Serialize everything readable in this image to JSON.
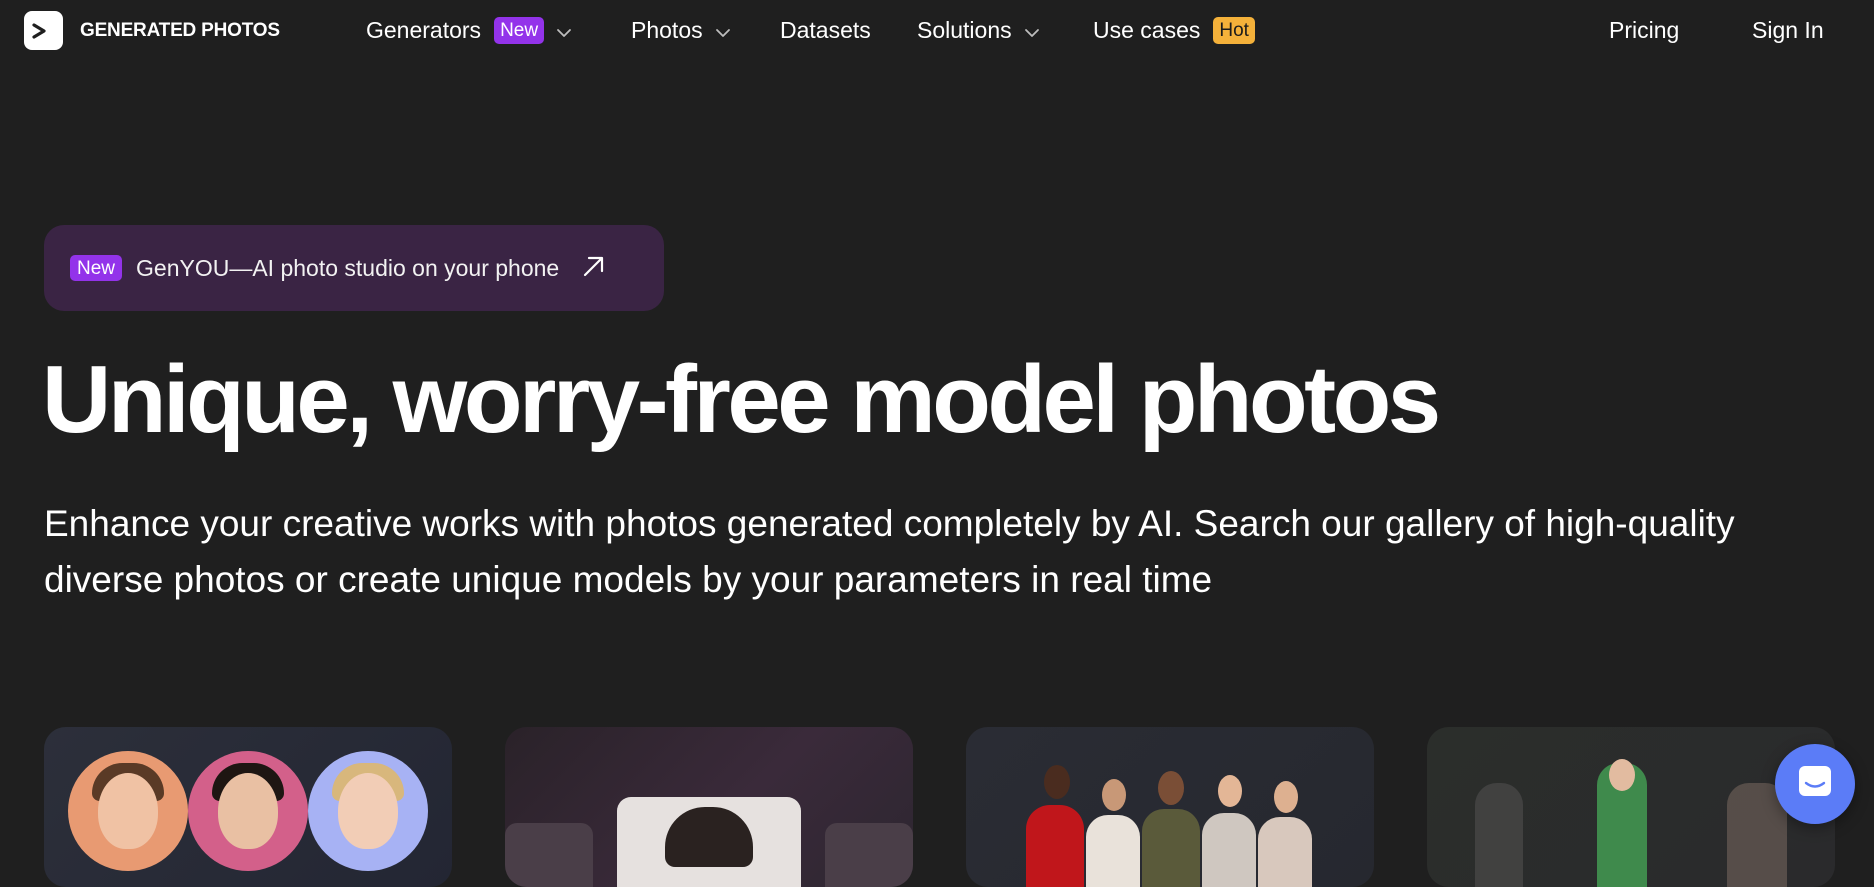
{
  "brand": {
    "name": "GENERATED PHOTOS",
    "logo_glyph": ">"
  },
  "nav": {
    "items": [
      {
        "label": "Generators",
        "badge": "New",
        "dropdown": true
      },
      {
        "label": "Photos",
        "dropdown": true
      },
      {
        "label": "Datasets"
      },
      {
        "label": "Solutions",
        "dropdown": true
      },
      {
        "label": "Use cases",
        "badge": "Hot"
      }
    ],
    "pricing": "Pricing",
    "sign_in": "Sign In"
  },
  "promo": {
    "badge": "New",
    "text": "GenYOU—AI photo studio on your phone"
  },
  "hero": {
    "title": "Unique, worry-free model photos",
    "subtitle": "Enhance your creative works with photos generated completely by AI. Search our gallery of high-quality diverse photos or create unique models by your parameters in real time"
  },
  "colors": {
    "background": "#1f1f1f",
    "badge_new": "#9333ea",
    "badge_hot": "#f4b13a",
    "promo_bg": "#3a2444",
    "chat_button": "#5b7cf7"
  },
  "icons": {
    "promo_arrow": "arrow-up-right-icon",
    "dropdown": "chevron-down-icon",
    "chat": "chat-icon"
  }
}
